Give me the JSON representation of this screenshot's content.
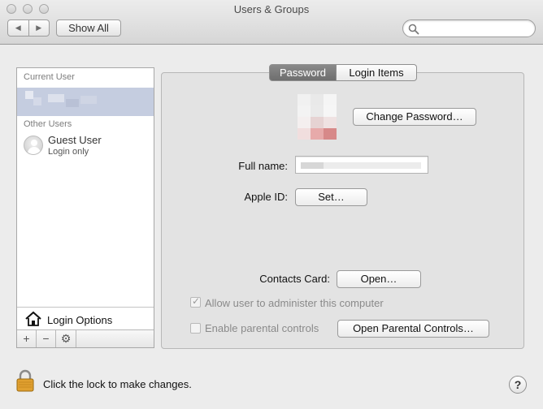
{
  "window": {
    "title": "Users & Groups"
  },
  "toolbar": {
    "back_glyph": "◀",
    "forward_glyph": "▶",
    "show_all_label": "Show All",
    "search_placeholder": ""
  },
  "sidebar": {
    "current_user_heading": "Current User",
    "other_users_heading": "Other Users",
    "guest": {
      "name": "Guest User",
      "subtitle": "Login only"
    },
    "login_options_label": "Login Options",
    "bar": {
      "add": "+",
      "remove": "−",
      "gear": "⚙"
    }
  },
  "tabs": [
    {
      "label": "Password",
      "selected": true
    },
    {
      "label": "Login Items",
      "selected": false
    }
  ],
  "password": {
    "change_password_button": "Change Password…",
    "full_name_label": "Full name:",
    "full_name_value": "",
    "apple_id_label": "Apple ID:",
    "apple_id_button": "Set…",
    "contacts_card_label": "Contacts Card:",
    "contacts_open_button": "Open…",
    "allow_admin": {
      "label": "Allow user to administer this computer",
      "checked": true,
      "enabled": false
    },
    "parental": {
      "label": "Enable parental controls",
      "checked": false,
      "enabled": false
    },
    "parental_button": "Open Parental Controls…"
  },
  "footer": {
    "lock_text": "Click the lock to make changes.",
    "help_glyph": "?"
  },
  "colors": {
    "selected_row": "#c5cde0",
    "tab_active": "#7b7b7b",
    "lock": "#e0a030"
  }
}
